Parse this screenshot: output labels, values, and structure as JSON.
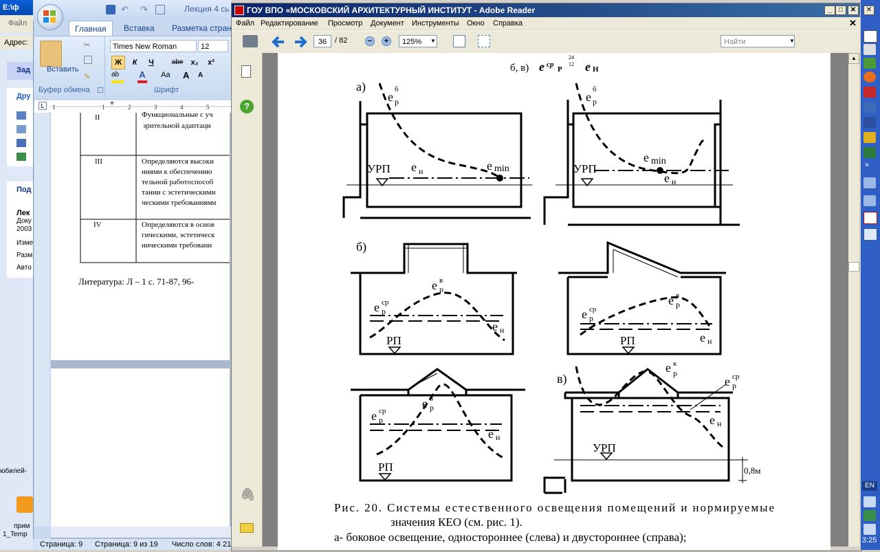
{
  "explorer": {
    "title": "E:\\ф",
    "address_label": "Адрес:",
    "panel1_title": "Зад",
    "panel2_title": "Дру",
    "panel3_title": "Под",
    "details_name": "Лек",
    "details_lines": [
      "Доку",
      "2003",
      "Изме",
      "Разм",
      "Авто"
    ],
    "file_label": "Файл",
    "desktop_label1": "юбилей-",
    "desktop_label2": "прим",
    "desktop_label3": "1_Temp"
  },
  "word": {
    "title": "Лекция  4  сь",
    "tabs": [
      "Главная",
      "Вставка",
      "Разметка страни"
    ],
    "paste_label": "Вставить",
    "group_clipboard": "Буфер обмена",
    "group_font": "Шрифт",
    "font_name": "Times New Roman",
    "font_size": "12",
    "format_buttons": [
      "Ж",
      "К",
      "Ч",
      "abe",
      "x₂",
      "x²"
    ],
    "table_rows": [
      {
        "num": "II",
        "text": [
          "Функциональные с уч",
          "зрительной адаптаци"
        ]
      },
      {
        "num": "III",
        "text": [
          "Определяются высоки",
          "ниями к обеспечению",
          "тельной работоспособ",
          "тании с эстетическими",
          "ческими требованиями"
        ]
      },
      {
        "num": "IV",
        "text": [
          "Определяются в основ",
          "гическими, эстетическ",
          "ническими требовани"
        ]
      }
    ],
    "literature": "Литература:   Л – 1  с. 71-87, 96-",
    "status": {
      "page": "Страница: 9",
      "pages": "Страница: 9 из 19",
      "words": "Число слов: 4 21"
    }
  },
  "reader": {
    "title": "ГОУ ВПО «МОСКОВСКИЙ АРХИТЕКТУРНЫЙ ИНСТИТУТ - Adobe Reader",
    "menu": [
      "Файл",
      "Редактирование",
      "Просмотр",
      "Документ",
      "Инструменты",
      "Окно",
      "Справка"
    ],
    "page_current": "36",
    "page_total": "/ 82",
    "zoom": "125%",
    "find_placeholder": "Найти"
  },
  "figure": {
    "header_text": "б, в)",
    "header_sym1": "e",
    "header_sup1": "ср",
    "header_sub1": "Р",
    "header_tiny": [
      "24",
      "12"
    ],
    "header_sym2": "e",
    "header_sub2": "Н",
    "section_a": "а)",
    "section_b": "б)",
    "section_v": "в)",
    "labels": {
      "e": "e",
      "sup_b": "б",
      "sup_v": "в",
      "sup_k": "к",
      "sup_sr": "ср",
      "sub_r": "р",
      "sub_n": "н",
      "min": "min",
      "urp": "УРП",
      "rp": "РП",
      "dim": "0,8м"
    },
    "caption_line1": "Рис.  20.   Системы  естественного  освещения  помещений  и  нормируемые",
    "caption_line2": "значения КЕО (см. рис. 1).",
    "caption_line3": "а- боковое освещение, одностороннее (слева) и двустороннее (справа);"
  },
  "tray": {
    "lang": "EN",
    "time": "3:25"
  }
}
